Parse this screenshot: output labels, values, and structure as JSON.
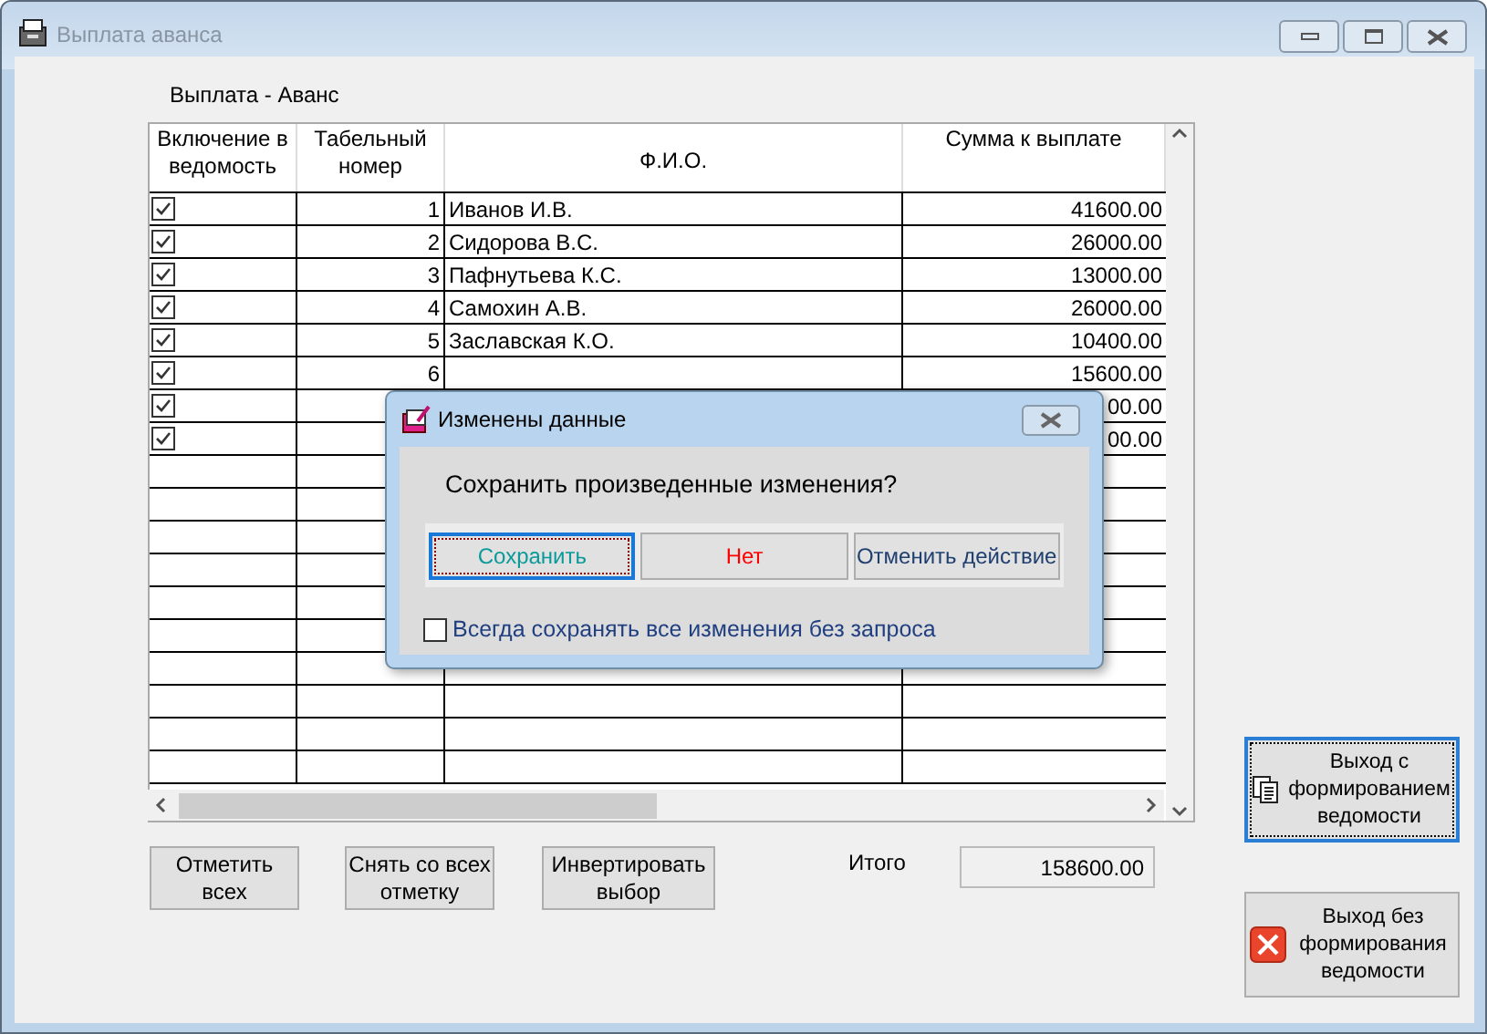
{
  "window": {
    "title": "Выплата аванса"
  },
  "caption": "Выплата - Аванс",
  "table": {
    "columns": [
      "Включение в ведомость",
      "Табельный номер",
      "Ф.И.О.",
      "Сумма к выплате"
    ],
    "rows": [
      {
        "included": true,
        "number": "1",
        "name": "Иванов И.В.",
        "amount": "41600.00"
      },
      {
        "included": true,
        "number": "2",
        "name": "Сидорова В.С.",
        "amount": "26000.00"
      },
      {
        "included": true,
        "number": "3",
        "name": "Пафнутьева К.С.",
        "amount": "13000.00"
      },
      {
        "included": true,
        "number": "4",
        "name": "Самохин А.В.",
        "amount": "26000.00"
      },
      {
        "included": true,
        "number": "5",
        "name": "Заславская К.О.",
        "amount": "10400.00"
      },
      {
        "included": true,
        "number": "6",
        "amount": "15600.00"
      },
      {
        "included": true,
        "amount": "00.00"
      },
      {
        "included": true,
        "amount": "00.00"
      }
    ]
  },
  "buttons": [
    "Отметить всех",
    "Снять со всех отметку",
    "Инвертировать выбор"
  ],
  "total": {
    "label": "Итого",
    "value": "158600.00"
  },
  "exit_buttons": [
    {
      "kind": "docs",
      "label": "Выход с формированием ведомости",
      "focused": true
    },
    {
      "kind": "cancel",
      "label": "Выход без формирования ведомости",
      "focused": false
    }
  ],
  "dialog": {
    "title": "Изменены данные",
    "message": "Сохранить произведенные изменения?",
    "buttons": [
      {
        "label": "Сохранить",
        "focused": true,
        "color": "#0a9a9a"
      },
      {
        "label": "Нет",
        "focused": false,
        "color": "#ff0000"
      },
      {
        "label": "Отменить действие",
        "focused": false,
        "color": "#1f3f6f"
      }
    ],
    "always_save": {
      "label": "Всегда сохранять все изменения без запроса",
      "checked": false
    }
  }
}
